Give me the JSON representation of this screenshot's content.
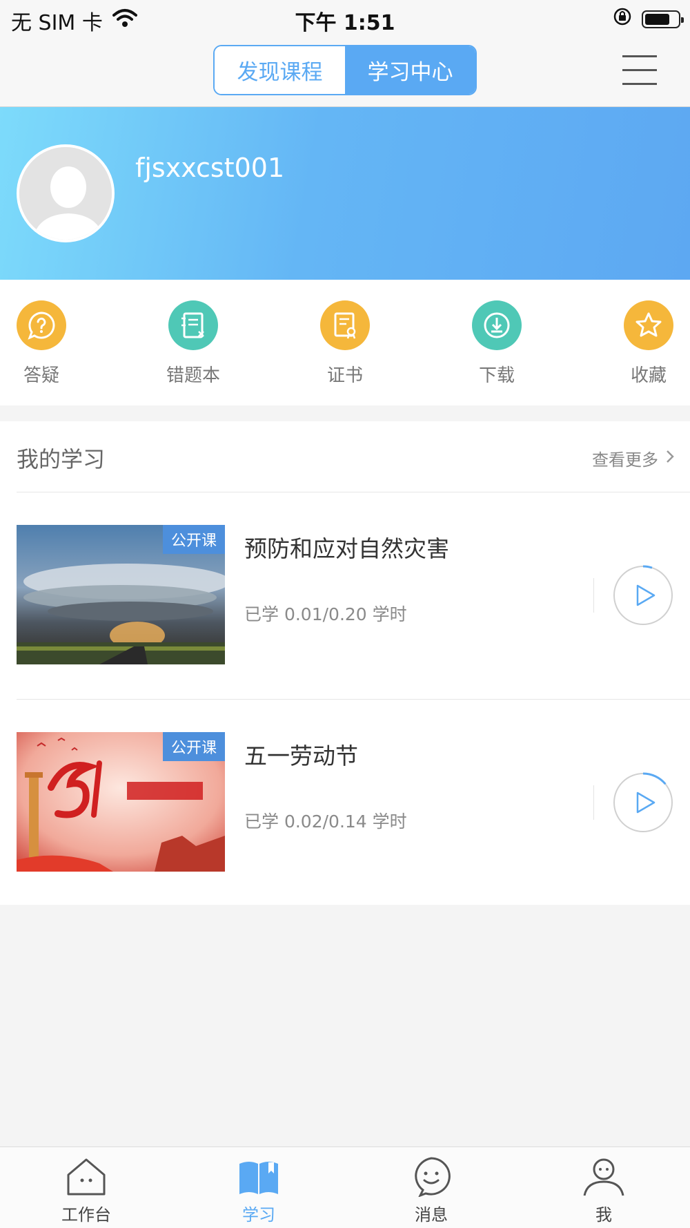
{
  "status_bar": {
    "carrier": "无 SIM 卡",
    "time": "下午 1:51",
    "battery_level": 0.72
  },
  "header": {
    "tabs": [
      {
        "label": "发现课程",
        "active": false
      },
      {
        "label": "学习中心",
        "active": true
      }
    ],
    "menu_icon": "hamburger-menu-icon"
  },
  "profile": {
    "username": "fjsxxcst001",
    "avatar_icon": "default-avatar-icon"
  },
  "quick_actions": [
    {
      "label": "答疑",
      "icon": "question-chat-icon",
      "color": "#f5b73b"
    },
    {
      "label": "错题本",
      "icon": "notebook-icon",
      "color": "#4fc8b6"
    },
    {
      "label": "证书",
      "icon": "certificate-icon",
      "color": "#f5b73b"
    },
    {
      "label": "下载",
      "icon": "download-icon",
      "color": "#4fc8b6"
    },
    {
      "label": "收藏",
      "icon": "star-icon",
      "color": "#f5b73b"
    }
  ],
  "my_study": {
    "title": "我的学习",
    "more_label": "查看更多",
    "courses": [
      {
        "tag": "公开课",
        "title": "预防和应对自然灾害",
        "progress": "已学 0.01/0.20 学时",
        "progress_value": 0.05,
        "thumbnail": "storm-landscape"
      },
      {
        "tag": "公开课",
        "title": "五一劳动节",
        "progress": "已学 0.02/0.14 学时",
        "progress_value": 0.14,
        "thumbnail": "labor-day-poster"
      }
    ]
  },
  "tab_bar": [
    {
      "label": "工作台",
      "icon": "house-icon",
      "active": false
    },
    {
      "label": "学习",
      "icon": "book-icon",
      "active": true
    },
    {
      "label": "消息",
      "icon": "message-face-icon",
      "active": false
    },
    {
      "label": "我",
      "icon": "person-icon",
      "active": false
    }
  ],
  "colors": {
    "accent": "#5aa9f3",
    "banner_start": "#7ddbfb",
    "banner_end": "#5da8f2",
    "tag_bg": "#4d8fdc"
  }
}
